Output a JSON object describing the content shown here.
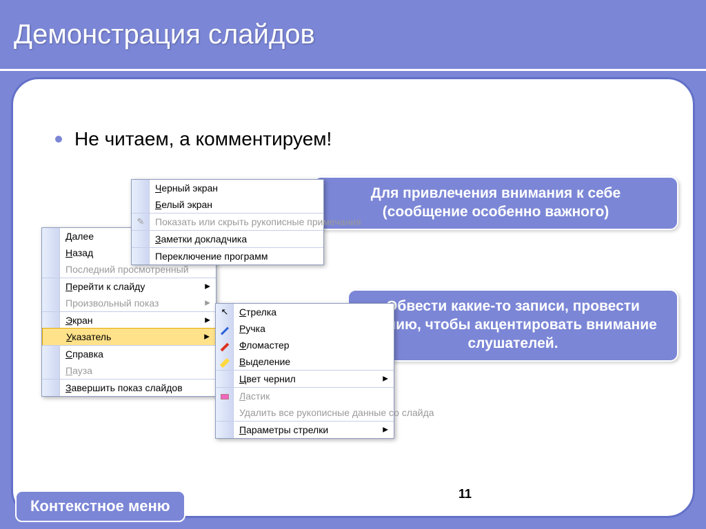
{
  "slide": {
    "title": "Демонстрация слайдов",
    "bullet": "Не читаем, а комментируем!",
    "number": "11",
    "bottom_label": "Контекстное меню"
  },
  "callouts": {
    "c1": "Для привлечения  внимания к себе (сообщение особенно важного)",
    "c2": "Обвести какие-то записи, провести линию, чтобы акцентировать внимание слушателей."
  },
  "menu_main": {
    "items": [
      {
        "label": "Далее"
      },
      {
        "label": "Назад",
        "underline": "Н"
      },
      {
        "label": "Последний просмотренный",
        "disabled": true,
        "sep": false
      },
      {
        "label": "Перейти к слайду",
        "sep": true,
        "arrow": true,
        "underline": "П"
      },
      {
        "label": "Произвольный показ",
        "disabled": true,
        "arrow": true
      },
      {
        "label": "Экран",
        "sep": true,
        "arrow": true,
        "underline": "Э"
      },
      {
        "label": "Указатель",
        "highlight": true,
        "arrow": true,
        "underline": "У"
      },
      {
        "label": "Справка",
        "sep": true,
        "underline": "С"
      },
      {
        "label": "Пауза",
        "disabled": true,
        "underline": "П"
      },
      {
        "label": "Завершить показ слайдов",
        "sep": true,
        "underline": "З"
      }
    ]
  },
  "menu_screen": {
    "items": [
      {
        "label": "Черный экран",
        "underline": "Ч"
      },
      {
        "label": "Белый экран",
        "underline": "Б"
      },
      {
        "label": "Показать или скрыть рукописные примечания",
        "disabled": true,
        "sep": true,
        "icon": "✎"
      },
      {
        "label": "Заметки докладчика",
        "sep": true,
        "underline": "З"
      },
      {
        "label": "Переключение программ",
        "sep": true
      }
    ]
  },
  "menu_pointer": {
    "items": [
      {
        "label": "Стрелка",
        "icon": "↖",
        "underline": "С"
      },
      {
        "label": "Ручка",
        "icon": "pen-blue",
        "underline": "Р"
      },
      {
        "label": "Фломастер",
        "icon": "pen-red",
        "underline": "Ф"
      },
      {
        "label": "Выделение",
        "icon": "hl",
        "underline": "В"
      },
      {
        "label": "Цвет чернил",
        "sep": true,
        "arrow": true,
        "underline": "Ц"
      },
      {
        "label": "Ластик",
        "disabled": true,
        "sep": true,
        "icon": "eraser",
        "underline": "Л"
      },
      {
        "label": "Удалить все рукописные данные со слайда",
        "disabled": true
      },
      {
        "label": "Параметры стрелки",
        "sep": true,
        "arrow": true,
        "underline": "П"
      }
    ]
  }
}
